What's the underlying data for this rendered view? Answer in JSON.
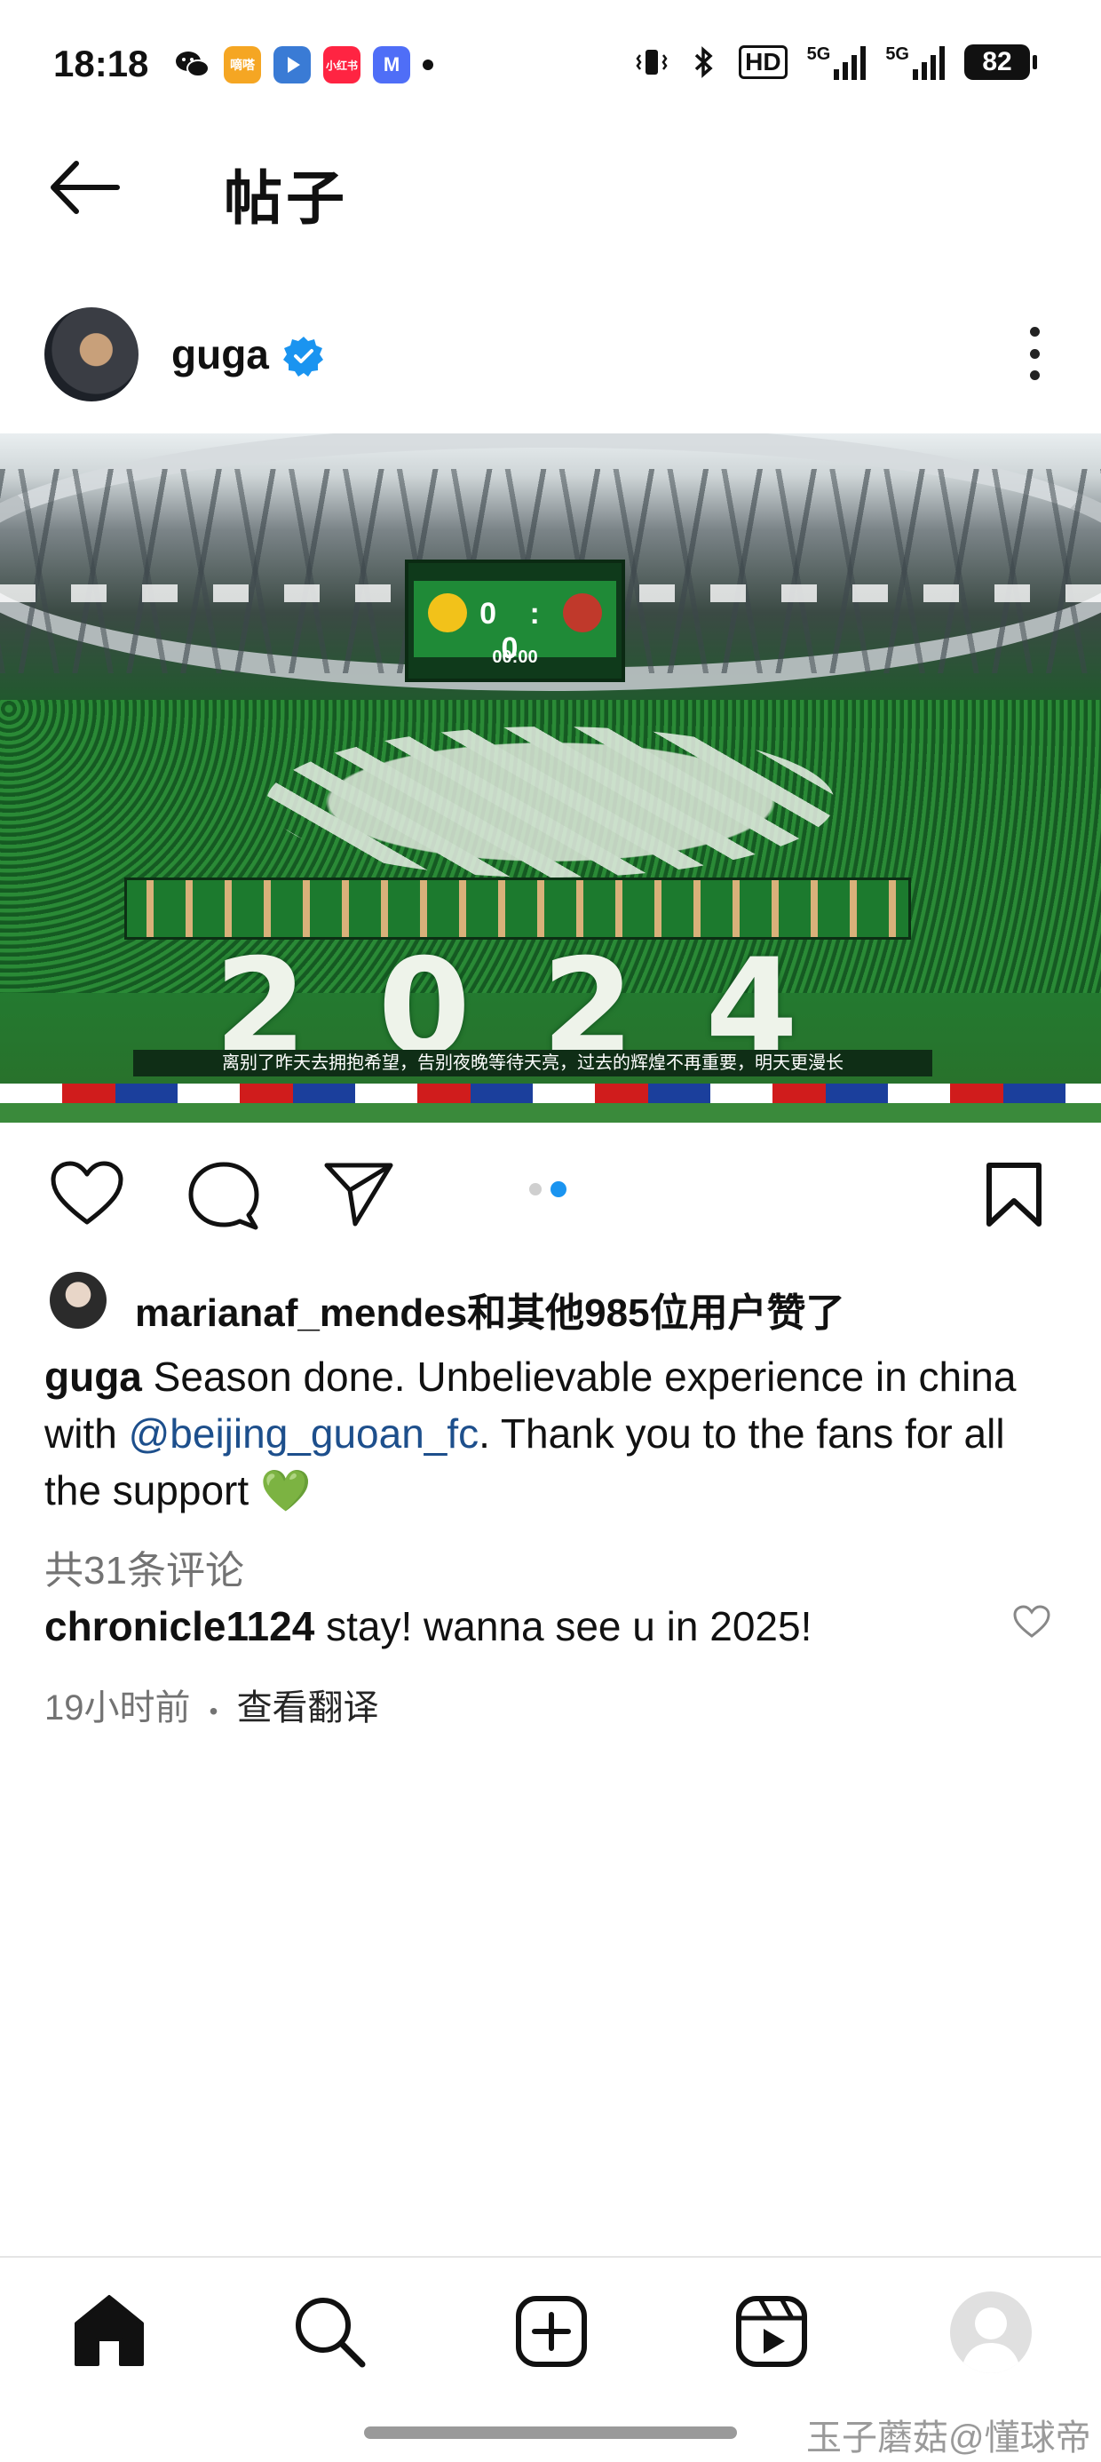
{
  "status_bar": {
    "time": "18:18",
    "apps": [
      {
        "name": "wechat-icon",
        "label": "",
        "color": "#111111"
      },
      {
        "name": "app-orange-icon",
        "label": "嘀嗒",
        "color": "#f5a623"
      },
      {
        "name": "app-video-icon",
        "label": "",
        "color": "#3a7bd5"
      },
      {
        "name": "xiaohongshu-icon",
        "label": "小红书",
        "color": "#ff2442"
      },
      {
        "name": "app-m-icon",
        "label": "M",
        "color": "#4f6ef7"
      }
    ],
    "hd_label": "HD",
    "network_1": "5G",
    "network_2": "5G",
    "battery": "82"
  },
  "header": {
    "title": "帖子"
  },
  "post": {
    "author": "guga",
    "verified": true,
    "image": {
      "scoreboard_score": "0 : 0",
      "scoreboard_time": "00:00",
      "tifo_year": "2024",
      "slogan": "离别了昨天去拥抱希望，告别夜晚等待天亮，过去的辉煌不再重要，明天更漫长"
    },
    "carousel_total": 2,
    "carousel_index": 2,
    "likes_text": "marianaf_mendes和其他985位用户赞了",
    "caption_user": "guga",
    "caption_before_mention": " Season done. Unbelievable experience in china with ",
    "caption_mention": "@beijing_guoan_fc",
    "caption_after_mention": ". Thank you to the fans for all the support 💚",
    "comments_count": "共31条评论",
    "comment": {
      "user": "chronicle1124",
      "text": " stay! wanna see u in 2025!",
      "time": "19小时前",
      "separator": "•",
      "translate": "查看翻译"
    }
  },
  "bottom_nav": {
    "items": [
      "home-icon",
      "search-icon",
      "create-icon",
      "reels-icon",
      "profile-avatar"
    ]
  },
  "watermark": "玉子蘑菇@懂球帝",
  "colors": {
    "accent": "#1a94f0",
    "mention": "#1d4f8c",
    "secondary_text": "#737373"
  }
}
